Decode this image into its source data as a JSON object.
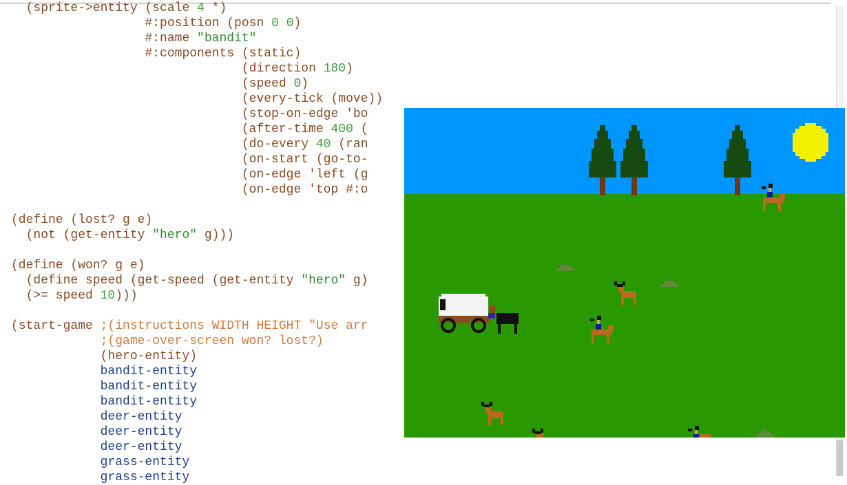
{
  "editor": {
    "lines": [
      {
        "t": "  (sprite->entity (scale 4 *)"
      },
      {
        "t": "                  #:position (posn 0 0)"
      },
      {
        "t": "                  #:name \"bandit\""
      },
      {
        "t": "                  #:components (static)"
      },
      {
        "t": "                               (direction 180)"
      },
      {
        "t": "                               (speed 0)"
      },
      {
        "t": "                               (every-tick (move))"
      },
      {
        "t": "                               (stop-on-edge 'bo"
      },
      {
        "t": "                               (after-time 400 ("
      },
      {
        "t": "                               (do-every 40 (ran"
      },
      {
        "t": "                               (on-start (go-to-"
      },
      {
        "t": "                               (on-edge 'left (g"
      },
      {
        "t": "                               (on-edge 'top #:o"
      },
      {
        "t": ""
      },
      {
        "t": "(define (lost? g e)"
      },
      {
        "t": "  (not (get-entity \"hero\" g)))"
      },
      {
        "t": ""
      },
      {
        "t": "(define (won? g e)"
      },
      {
        "t": "  (define speed (get-speed (get-entity \"hero\" g)"
      },
      {
        "t": "  (>= speed 10)))"
      },
      {
        "t": ""
      },
      {
        "t": "(start-game ;(instructions WIDTH HEIGHT \"Use arr"
      },
      {
        "t": "            ;(game-over-screen won? lost?)"
      },
      {
        "t": "            (hero-entity)"
      },
      {
        "t": "            bandit-entity"
      },
      {
        "t": "            bandit-entity"
      },
      {
        "t": "            bandit-entity"
      },
      {
        "t": "            deer-entity"
      },
      {
        "t": "            deer-entity"
      },
      {
        "t": "            deer-entity"
      },
      {
        "t": "            grass-entity"
      },
      {
        "t": "            grass-entity"
      }
    ]
  },
  "game": {
    "sky_color": "#0096ff",
    "grass_color": "#2a9800",
    "sprites": [
      "pine-tree",
      "pine-tree",
      "pine-tree",
      "sun",
      "bandit-rider",
      "bandit-rider",
      "bandit-rider",
      "deer",
      "deer",
      "deer",
      "grass-tuft",
      "grass-tuft",
      "grass-tuft",
      "covered-wagon"
    ]
  }
}
